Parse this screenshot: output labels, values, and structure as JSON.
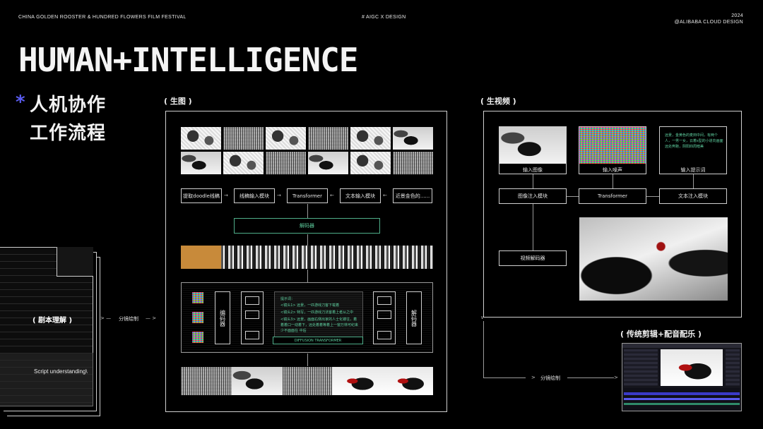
{
  "header": {
    "festival": "CHINA GOLDEN ROOSTER & HUNDRED FLOWERS FILM FESTIVAL",
    "tag": "# AIGC X DESIGN",
    "year": "2024",
    "brand": "@ALIBABA CLOUD DESIGN"
  },
  "hero": {
    "title": "HUMAN+INTELLIGENCE",
    "star": "*",
    "subtitle_line1": "人机协作",
    "subtitle_line2": "工作流程"
  },
  "script_doc": {
    "label": "( 剧本理解 )",
    "caption": "Script understanding\\"
  },
  "flow_labels": {
    "storyboard_1": "分镜绘制",
    "storyboard_2": "分镜绘制"
  },
  "image_gen": {
    "section": "( 生图 )",
    "pipeline": [
      "提取doodle线稿",
      "线稿输入模块",
      "Transformer",
      "文本输入模块",
      "近景金色的......"
    ],
    "decoder": "解码器",
    "encoder_label": "编码器",
    "decoder_label": "解码器",
    "dit_label": "DIFFUSION TRANSFORMER",
    "prompt_title": "提示词：",
    "prompt_lines": [
      "<镜头1> 远景，一匹游戏刀客下载着",
      "<镜头2> 特写，一匹游戏刀法客着上者从之中",
      "<镜头3> 远景，画面右侧出家的人士化镂往，着着着口一动着下，远处着着等着上一窗万林可纪来少不面面在 中后"
    ]
  },
  "video_gen": {
    "section": "( 生视频 )",
    "inputs": [
      "输入图像",
      "输入噪声",
      "输入提示词"
    ],
    "prompt_text": "远景，金黄色的麦田中间，有两个人，一男一女，云着s型的小道向画面远处奔跑，阴阳四周暗美",
    "modules": [
      "图像注入模块",
      "Transformer",
      "文本注入模块"
    ],
    "video_decoder": "视频解码器"
  },
  "editing": {
    "section": "( 传统剪辑+配音配乐 )"
  },
  "colors": {
    "accent": "#5a5cf0",
    "green": "#5fd0a0",
    "line": "#cfcfcf"
  }
}
